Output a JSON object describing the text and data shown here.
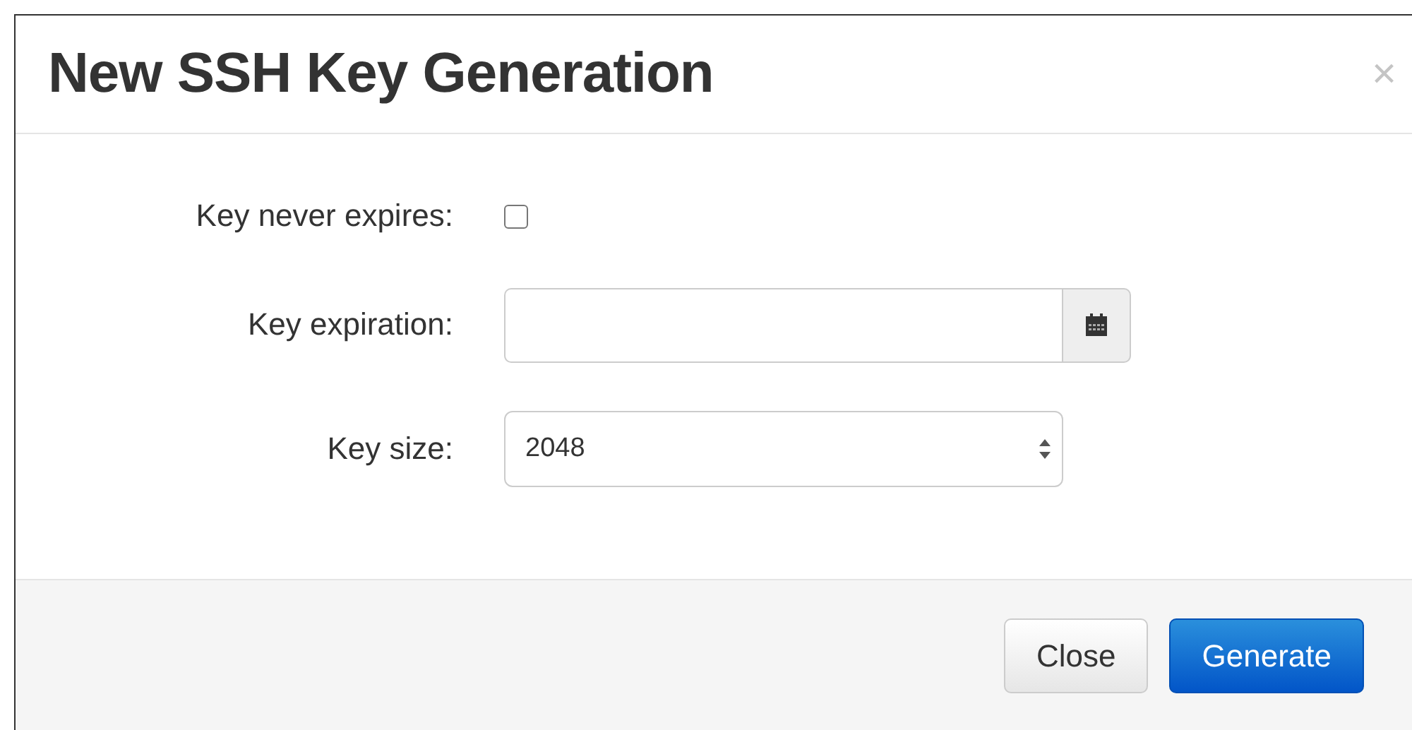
{
  "dialog": {
    "title": "New SSH Key Generation",
    "close": "×"
  },
  "fields": [
    {
      "kind": "checkbox",
      "label": "Key never expires:",
      "checked": false
    },
    {
      "kind": "date",
      "label": "Key expiration:"
    },
    {
      "kind": "select",
      "label": "Key size:",
      "value": "2048"
    }
  ],
  "buttons": [
    {
      "kind": "default",
      "label": "Close"
    },
    {
      "kind": "primary",
      "label": "Generate"
    }
  ]
}
